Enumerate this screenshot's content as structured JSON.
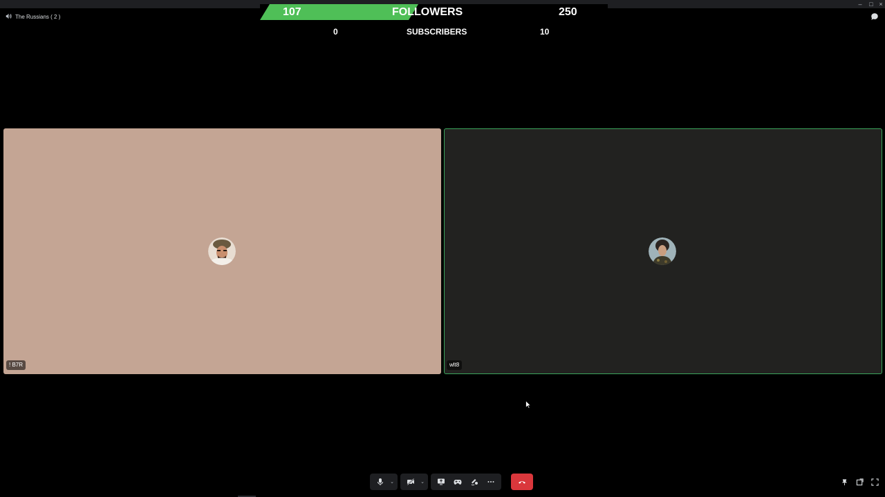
{
  "window": {
    "minimize": "–",
    "maximize": "□",
    "close": "×"
  },
  "channel": {
    "name": "The Russians ( 2 )",
    "icon": "speaker-icon"
  },
  "goals": {
    "followers": {
      "current": "107",
      "label": "FOLLOWERS",
      "goal": "250",
      "progress": 0.428,
      "color": "#4fbf57"
    },
    "subscribers": {
      "current": "0",
      "label": "SUBSCRIBERS",
      "goal": "10"
    }
  },
  "participants": [
    {
      "name": "! B7R",
      "tile_color": "#c4a594",
      "avatar": "user-avatar-icon"
    },
    {
      "name": "wlt8",
      "tile_color": "#222220",
      "avatar": "user-avatar-icon",
      "speaking": true,
      "border_color": "#3ba55c"
    }
  ],
  "controls": {
    "mute": "microphone-icon",
    "camera": "camera-off-icon",
    "screen_share": "screen-share-icon",
    "activity": "gamepad-icon",
    "soundboard": "soundboard-icon",
    "more": "more-icon",
    "disconnect": "phone-hangup-icon",
    "disconnect_color": "#da373c",
    "chevron": "⌄"
  },
  "corner_controls": [
    "pin-icon",
    "popout-icon",
    "fullscreen-icon"
  ]
}
